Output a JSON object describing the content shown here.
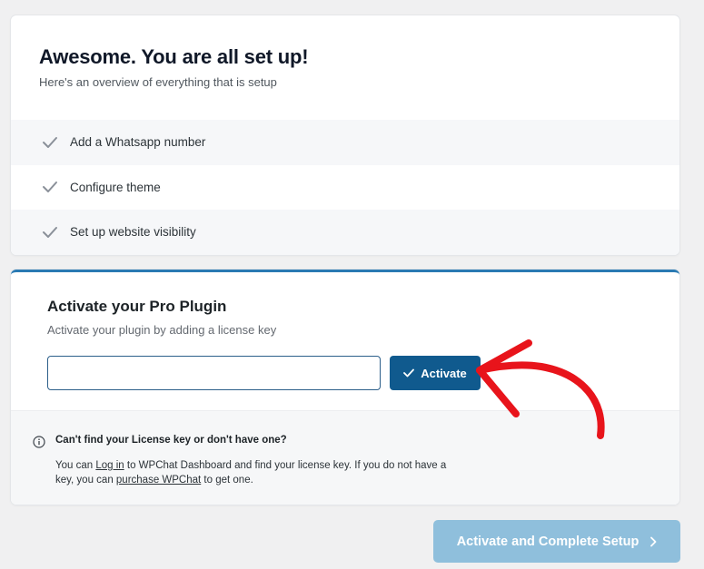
{
  "summary": {
    "title": "Awesome. You are all set up!",
    "subtitle": "Here's an overview of everything that is setup",
    "items": [
      {
        "label": "Add a Whatsapp number",
        "icon": "checkmark-icon"
      },
      {
        "label": "Configure theme",
        "icon": "checkmark-icon"
      },
      {
        "label": "Set up website visibility",
        "icon": "checkmark-icon"
      }
    ]
  },
  "license": {
    "title": "Activate your Pro Plugin",
    "subtitle": "Activate your plugin by adding a license key",
    "input_value": "",
    "input_placeholder": "",
    "activate_label": "Activate",
    "help_heading": "Can't find your License key or don't have one?",
    "help_text_1": "You can ",
    "login_link": "Log in",
    "help_text_2": " to WPChat Dashboard and find your license key. If you do not have a key, you can ",
    "purchase_link": "purchase WPChat",
    "help_text_3": " to get one."
  },
  "footer": {
    "complete_label": "Activate and Complete Setup"
  },
  "colors": {
    "accent": "#2a7ab3",
    "primary_button": "#105a8e",
    "disabled_button": "#8fbfdc",
    "annotation_arrow": "#e8141b"
  }
}
